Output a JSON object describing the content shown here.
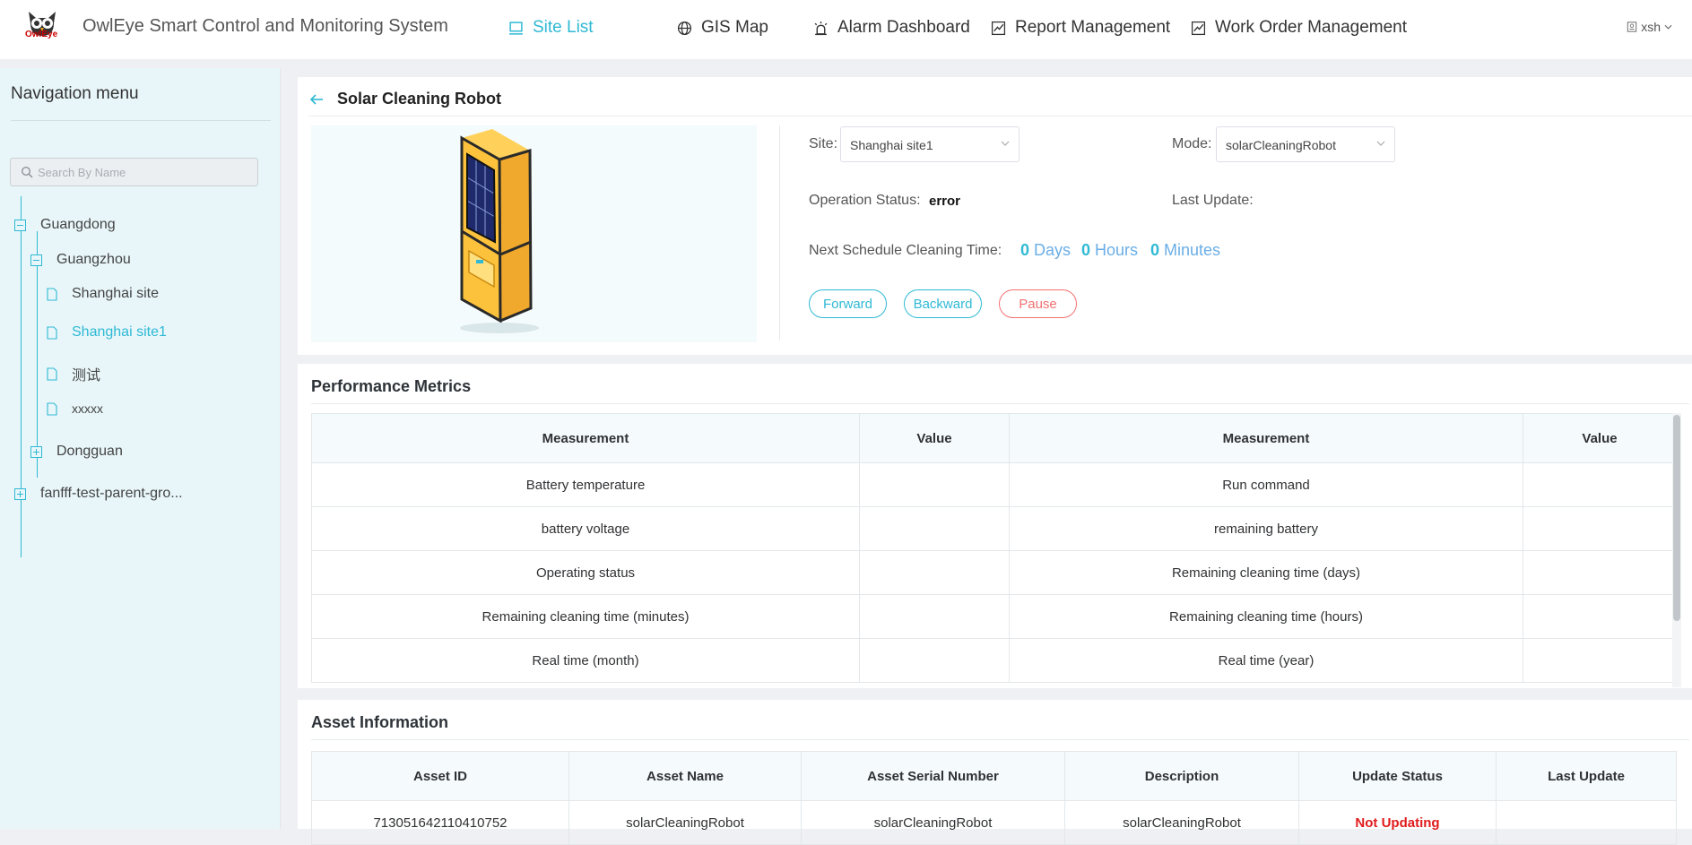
{
  "header": {
    "logo_text": "OwlEye",
    "app_title": "OwlEye Smart Control and Monitoring System",
    "nav": [
      {
        "label": "Site List",
        "icon": "monitor-icon",
        "active": true
      },
      {
        "label": "GIS Map",
        "icon": "globe-icon"
      },
      {
        "label": "Alarm Dashboard",
        "icon": "alarm-light-icon"
      },
      {
        "label": "Report Management",
        "icon": "line-chart-icon"
      },
      {
        "label": "Work Order Management",
        "icon": "line-chart-icon"
      }
    ],
    "user": "xsh"
  },
  "sidebar": {
    "title": "Navigation menu",
    "search_placeholder": "Search By Name",
    "tree": [
      {
        "label": "Guangdong",
        "expanded": true
      },
      {
        "label": "Guangzhou",
        "expanded": true
      },
      {
        "label": "Shanghai site"
      },
      {
        "label": "Shanghai site1",
        "selected": true
      },
      {
        "label": "测试"
      },
      {
        "label": "xxxxx"
      },
      {
        "label": "Dongguan",
        "expanded": false
      },
      {
        "label": "fanfff-test-parent-gro...",
        "expanded": false
      }
    ]
  },
  "device": {
    "title": "Solar Cleaning Robot",
    "site_label": "Site:",
    "site_value": "Shanghai site1",
    "mode_label": "Mode:",
    "mode_value": "solarCleaningRobot",
    "status_label": "Operation Status:",
    "status_value": "error",
    "last_update_label": "Last Update:",
    "schedule_label": "Next Schedule Cleaning Time:",
    "days_num": "0",
    "days_unit": "Days",
    "hours_num": "0",
    "hours_unit": "Hours",
    "minutes_num": "0",
    "minutes_unit": "Minutes",
    "btn_forward": "Forward",
    "btn_backward": "Backward",
    "btn_pause": "Pause"
  },
  "metrics": {
    "title": "Performance Metrics",
    "headers": [
      "Measurement",
      "Value",
      "Measurement",
      "Value"
    ],
    "rows": [
      [
        "Battery temperature",
        "",
        "Run command",
        ""
      ],
      [
        "battery voltage",
        "",
        "remaining battery",
        ""
      ],
      [
        "Operating status",
        "",
        "Remaining cleaning time (days)",
        ""
      ],
      [
        "Remaining cleaning time (minutes)",
        "",
        "Remaining cleaning time (hours)",
        ""
      ],
      [
        "Real time (month)",
        "",
        "Real time (year)",
        ""
      ]
    ]
  },
  "assets": {
    "title": "Asset Information",
    "headers": [
      "Asset ID",
      "Asset Name",
      "Asset Serial Number",
      "Description",
      "Update Status",
      "Last Update"
    ],
    "rows": [
      [
        "713051642110410752",
        "solarCleaningRobot",
        "solarCleaningRobot",
        "solarCleaningRobot",
        "Not Updating",
        ""
      ]
    ]
  },
  "colors": {
    "accent": "#2fb9d4",
    "error": "#e11b1b",
    "pause": "#f27171"
  }
}
